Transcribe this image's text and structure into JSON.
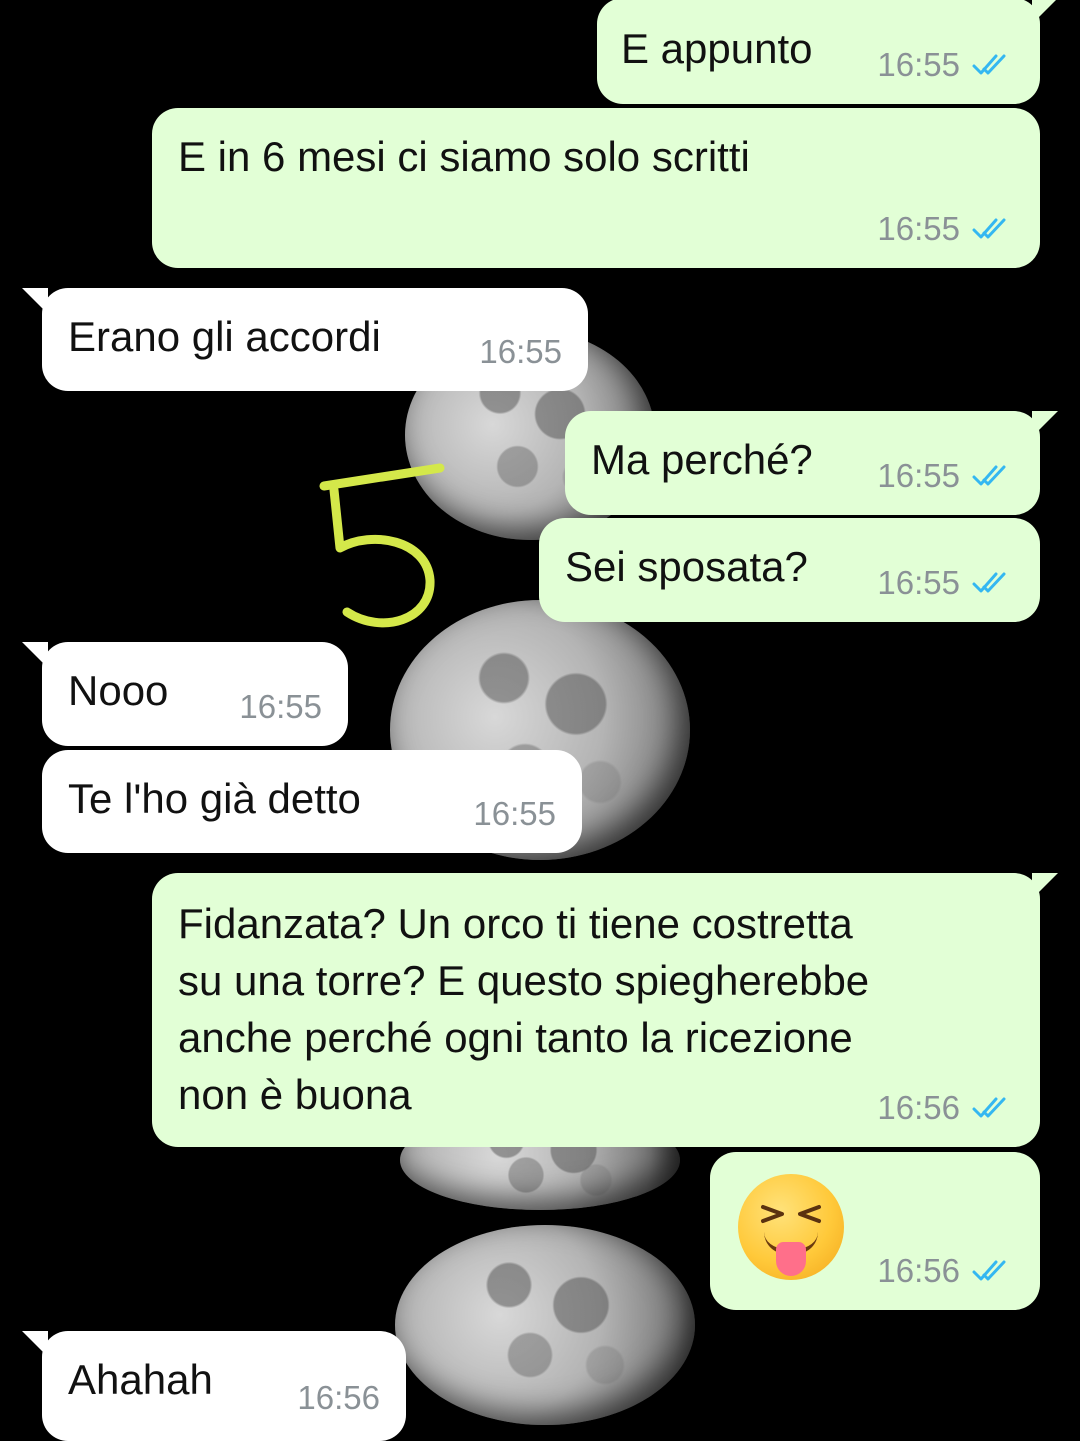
{
  "colors": {
    "background": "#000000",
    "outgoing_bubble": "#e2ffd6",
    "incoming_bubble": "#ffffff",
    "read_ticks": "#34b7f1",
    "timestamp": "#8a9196",
    "annotation": "#d4e84a"
  },
  "annotation": {
    "text": "5"
  },
  "messages": [
    {
      "direction": "out",
      "text": "E appunto",
      "time": "16:55",
      "status_icon": "double-check-read-icon"
    },
    {
      "direction": "out",
      "text": "E in 6 mesi ci siamo solo scritti",
      "time": "16:55",
      "status_icon": "double-check-read-icon"
    },
    {
      "direction": "in",
      "text": "Erano gli accordi",
      "time": "16:55"
    },
    {
      "direction": "out",
      "text": "Ma perché?",
      "time": "16:55",
      "status_icon": "double-check-read-icon"
    },
    {
      "direction": "out",
      "text": "Sei sposata?",
      "time": "16:55",
      "status_icon": "double-check-read-icon"
    },
    {
      "direction": "in",
      "text": "Nooo",
      "time": "16:55"
    },
    {
      "direction": "in",
      "text": "Te l'ho già detto",
      "time": "16:55"
    },
    {
      "direction": "out",
      "text": "Fidanzata? Un orco ti tiene costretta\nsu una torre? E questo spiegherebbe\nanche perché ogni tanto la ricezione\nnon è buona",
      "time": "16:56",
      "status_icon": "double-check-read-icon"
    },
    {
      "direction": "out",
      "emoji": "winking-face-with-tongue-emoji",
      "time": "16:56",
      "status_icon": "double-check-read-icon"
    },
    {
      "direction": "in",
      "text": "Ahahah",
      "time": "16:56"
    }
  ]
}
